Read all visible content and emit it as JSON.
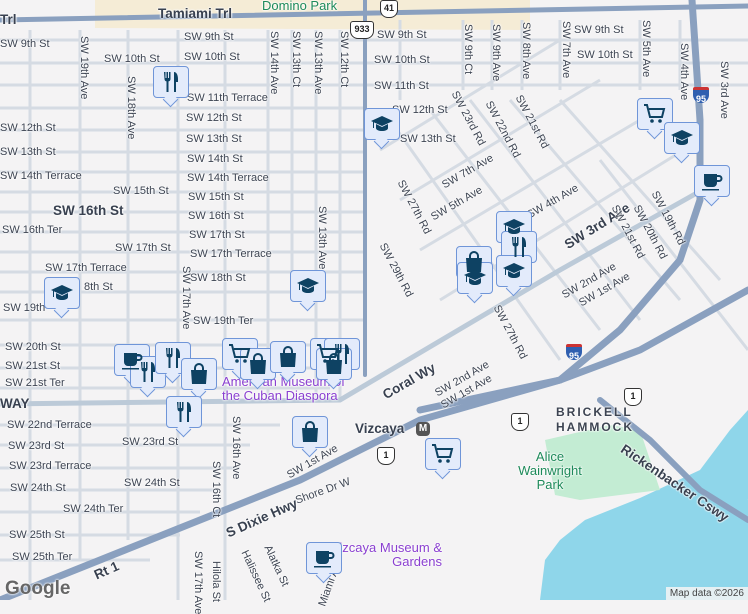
{
  "colors": {
    "background": "#f4f3f4",
    "major_road": "#8aa0bf",
    "minor_road": "#d5dbe3",
    "water": "#8fd6ea",
    "park": "#c3ecd3",
    "pin_bg": "#e3ebfb",
    "pin_icon": "#0e4263"
  },
  "places": {
    "domino_park": "Domino Park",
    "museum_cuban": "American Museum of the Cuban Diaspora",
    "vizcaya_museum": "Vizcaya Museum & Gardens",
    "alice_park": "Alice Wainwright Park",
    "brickell": "BRICKELL HAMMOCK",
    "vizcaya_station": "Vizcaya",
    "metro_glyph": "M"
  },
  "roads": {
    "tamiami": "Tamiami Trl",
    "tamiami_left": "Trl",
    "coral": "Coral Wy",
    "coral_left": "WAY",
    "dixie": "S Dixie Hwy",
    "rt1": "Rt 1",
    "rickenbacker": "Rickenbacker Cswy",
    "sw3rd": "SW 3rd Ave",
    "sw16th": "SW 16th St",
    "shore": "Shore Dr W"
  },
  "shields": {
    "us41": "41",
    "sr933": "933",
    "i95": "95",
    "us1": "1"
  },
  "streets": [
    "SW 9th St",
    "SW 12th St",
    "SW 13th St",
    "SW 14th Terrace",
    "SW 16th Ter",
    "SW 17th Terrace",
    "8th St",
    "SW 19th",
    "SW 20th St",
    "SW 21st St",
    "SW 21st Ter",
    "SW 22nd Terrace",
    "SW 23rd St",
    "SW 23rd Terrace",
    "SW 24th St",
    "SW 24th Ter",
    "SW 25th St",
    "SW 25th Ter",
    "SW 9th St",
    "SW 10th St",
    "SW 10th St",
    "SW 11th Terrace",
    "SW 12th St",
    "SW 13th St",
    "SW 14th St",
    "SW 14th Terrace",
    "SW 15th St",
    "SW 15th St",
    "SW 16th St",
    "SW 17th St",
    "SW 17th St",
    "SW 17th Terrace",
    "SW 18th St",
    "SW 19th Ter",
    "SW 23rd St",
    "SW 24th St",
    "SW 9th St",
    "SW 9th St",
    "SW 10th St",
    "SW 10th St",
    "SW 11th St",
    "SW 12th St",
    "SW 13th St"
  ],
  "avenues": [
    "SW 19th Ave",
    "SW 18th Ave",
    "SW 14th Ave",
    "SW 13th Ct",
    "SW 13th Ave",
    "SW 12th Ct",
    "SW 13th Ave",
    "SW 17th Ave",
    "SW 16th Ave",
    "SW 16th Ct",
    "SW 17th Ave",
    "Hilola St",
    "Halissee St",
    "Alatka St",
    "SW 9th Ct",
    "SW 9th Ave",
    "SW 8th Ave",
    "SW 7th Ave",
    "SW 5th Ave",
    "SW 4th Ave",
    "SW 3rd Ave",
    "SW 23rd Rd",
    "SW 22nd Rd",
    "SW 21st Rd",
    "SW 27th Rd",
    "SW 29th Rd",
    "SW 21st Rd",
    "SW 20th Rd",
    "SW 19th Rd",
    "SW 27th Rd",
    "Miami Ave"
  ],
  "diag": [
    "SW 7th Ave",
    "SW 5th Ave",
    "SW 2nd Ave",
    "SW 1st Ave",
    "SW 2nd Ave",
    "SW 1st Ave",
    "SW 1st Ave",
    "SW 4th Ave"
  ],
  "attribution": "Map data ©2026",
  "logo": "Google"
}
